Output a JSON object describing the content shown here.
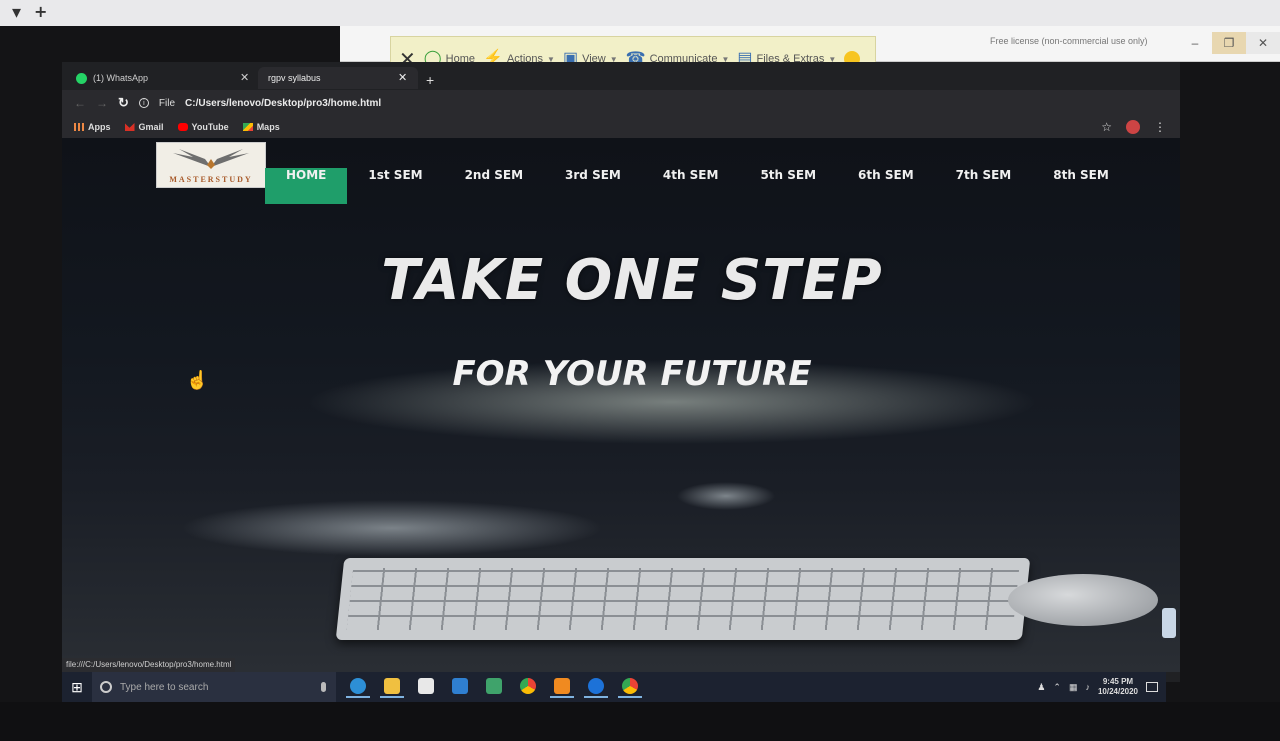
{
  "remote_toolbar": {
    "home": "Home",
    "actions": "Actions",
    "view": "View",
    "communicate": "Communicate",
    "files": "Files & Extras",
    "license": "Free license (non-commercial use only)"
  },
  "browser": {
    "tabs": [
      {
        "label": "(1) WhatsApp"
      },
      {
        "label": "rgpv syllabus"
      }
    ],
    "address": {
      "scheme_label": "File",
      "url": "C:/Users/lenovo/Desktop/pro3/home.html"
    },
    "bookmarks": [
      {
        "label": "Apps",
        "icon": "apps-grid-icon"
      },
      {
        "label": "Gmail",
        "icon": "gmail-icon"
      },
      {
        "label": "YouTube",
        "icon": "youtube-icon"
      },
      {
        "label": "Maps",
        "icon": "maps-icon"
      }
    ],
    "status_url": "file:///C:/Users/lenovo/Desktop/pro3/home.html"
  },
  "site": {
    "logo_text": "MASTERSTUDY",
    "nav": [
      {
        "label": "HOME",
        "active": true
      },
      {
        "label": "1st SEM"
      },
      {
        "label": "2nd SEM"
      },
      {
        "label": "3rd SEM"
      },
      {
        "label": "4th SEM"
      },
      {
        "label": "5th SEM"
      },
      {
        "label": "6th SEM"
      },
      {
        "label": "7th SEM"
      },
      {
        "label": "8th SEM"
      }
    ],
    "hero_title": "TAKE ONE STEP",
    "hero_subtitle": "FOR YOUR FUTURE",
    "accent_color": "#1f9e6a"
  },
  "taskbar": {
    "search_placeholder": "Type here to search",
    "time": "9:45 PM",
    "date": "10/24/2020"
  }
}
